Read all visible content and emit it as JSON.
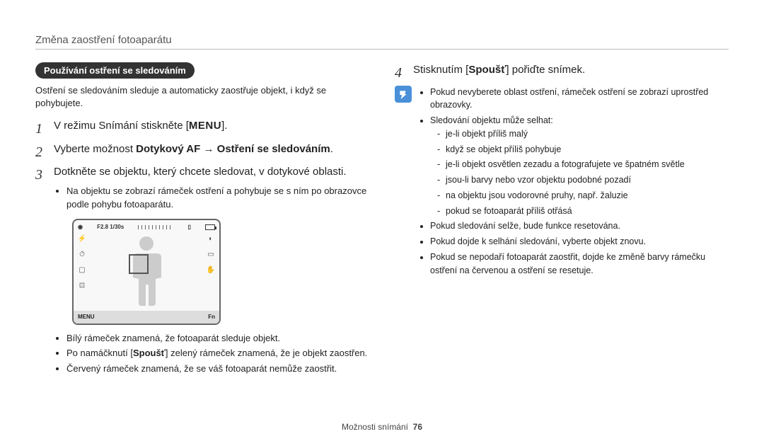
{
  "header": {
    "title": "Změna zaostření fotoaparátu"
  },
  "left": {
    "section_label": "Používání ostření se sledováním",
    "intro": "Ostření se sledováním sleduje a automaticky zaostřuje objekt, i když se pohybujete.",
    "step1_pre": "V režimu Snímání stiskněte [",
    "step1_menu": "MENU",
    "step1_post": "].",
    "step2_pre": "Vyberte možnost ",
    "step2_b1": "Dotykový AF",
    "step2_arrow": " → ",
    "step2_b2": "Ostření se sledováním",
    "step2_post": ".",
    "step3": "Dotkněte se objektu, který chcete sledovat, v dotykové oblasti.",
    "step3_sub1": "Na objektu se zobrazí rámeček ostření a pohybuje se s ním po obrazovce podle pohybu fotoaparátu.",
    "screen": {
      "aperture": "F2.8 1/30s",
      "menu": "MENU",
      "fn": "Fn"
    },
    "under1": "Bílý rámeček znamená, že fotoaparát sleduje objekt.",
    "under2_pre": "Po namáčknutí [",
    "under2_b": "Spoušť",
    "under2_post": "] zelený rámeček znamená, že je objekt zaostřen.",
    "under3": "Červený rámeček znamená, že se váš fotoaparát nemůže zaostřit."
  },
  "right": {
    "step4_pre": "Stisknutím [",
    "step4_b": "Spoušť",
    "step4_post": "] pořiďte snímek.",
    "note": {
      "n1": "Pokud nevyberete oblast ostření, rámeček ostření se zobrazí uprostřed obrazovky.",
      "n2": "Sledování objektu může selhat:",
      "n2a": "je-li objekt příliš malý",
      "n2b": "když se objekt příliš pohybuje",
      "n2c": "je-li objekt osvětlen zezadu a fotografujete ve špatném světle",
      "n2d": "jsou-li barvy nebo vzor objektu podobné pozadí",
      "n2e": "na objektu jsou vodorovné pruhy, např. žaluzie",
      "n2f": "pokud se fotoaparát příliš otřásá",
      "n3": "Pokud sledování selže, bude funkce resetována.",
      "n4": "Pokud dojde k selhání sledování, vyberte objekt znovu.",
      "n5": "Pokud se nepodaří fotoaparát zaostřit, dojde ke změně barvy rámečku ostření na červenou a ostření se resetuje."
    }
  },
  "footer": {
    "section": "Možnosti snímání",
    "page": "76"
  }
}
